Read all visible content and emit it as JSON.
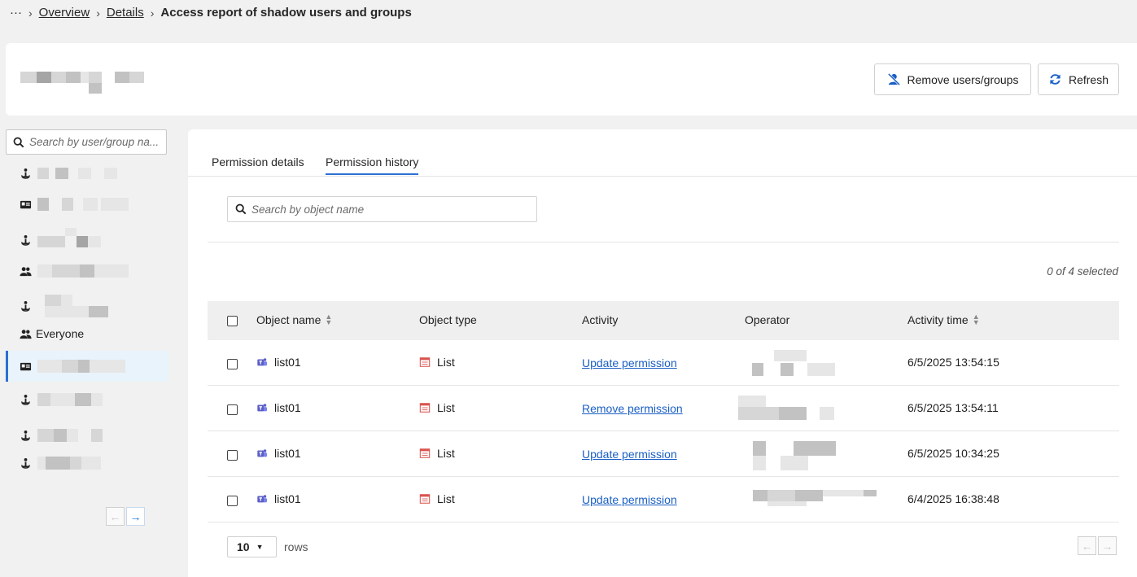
{
  "breadcrumb": {
    "ellipsis": "···",
    "items": [
      "Overview",
      "Details"
    ],
    "current": "Access report of shadow users and groups"
  },
  "header": {
    "remove_label": "Remove users/groups",
    "refresh_label": "Refresh"
  },
  "sidebar": {
    "search_placeholder": "Search by user/group na...",
    "items": [
      {
        "icon": "user-icon",
        "label": ""
      },
      {
        "icon": "id-card-icon",
        "label": ""
      },
      {
        "icon": "user-icon",
        "label": ""
      },
      {
        "icon": "group-icon",
        "label": ""
      },
      {
        "icon": "user-icon",
        "label": ""
      },
      {
        "icon": "group-icon",
        "label": "Everyone"
      },
      {
        "icon": "id-card-icon",
        "label": "",
        "active": true
      },
      {
        "icon": "user-icon",
        "label": ""
      },
      {
        "icon": "user-icon",
        "label": ""
      },
      {
        "icon": "user-icon",
        "label": ""
      }
    ]
  },
  "tabs": [
    {
      "label": "Permission details",
      "active": false
    },
    {
      "label": "Permission history",
      "active": true
    }
  ],
  "main": {
    "search_placeholder": "Search by object name",
    "selected_count": "0 of 4 selected",
    "columns": [
      "Object name",
      "Object type",
      "Activity",
      "Operator",
      "Activity time"
    ],
    "rows": [
      {
        "object_name": "list01",
        "object_type": "List",
        "activity": "Update permission",
        "time": "6/5/2025 13:54:15"
      },
      {
        "object_name": "list01",
        "object_type": "List",
        "activity": "Remove permission",
        "time": "6/5/2025 13:54:11"
      },
      {
        "object_name": "list01",
        "object_type": "List",
        "activity": "Update permission",
        "time": "6/5/2025 10:34:25"
      },
      {
        "object_name": "list01",
        "object_type": "List",
        "activity": "Update permission",
        "time": "6/4/2025 16:38:48"
      }
    ],
    "page_size": "10",
    "rows_label": "rows"
  },
  "colors": {
    "accent": "#2b6fd3",
    "link": "#1a5fc4",
    "teams_icon": "#5b5fc7",
    "list_icon": "#d9534f"
  }
}
